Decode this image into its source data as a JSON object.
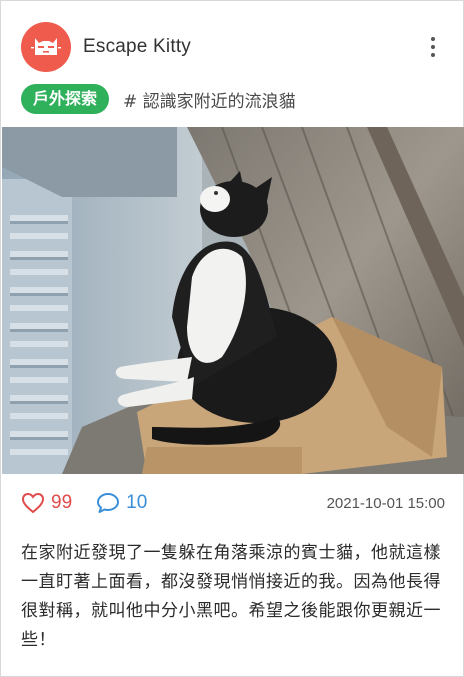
{
  "post": {
    "author": "Escape Kitty",
    "category": "戶外探索",
    "hashtag": "# 認識家附近的流浪貓",
    "likes": "99",
    "comments": "10",
    "timestamp": "2021-10-01 15:00",
    "body": "在家附近發現了一隻躲在角落乘涼的賓士貓，他就這樣一直盯著上面看，都沒發現悄悄接近的我。因為他長得很對稱，就叫他中分小黑吧。希望之後能跟你更親近一些！"
  },
  "icons": {
    "avatar": "cat-face-icon",
    "menu": "more-vertical-icon",
    "like": "heart-outline-icon",
    "comment": "comment-bubble-icon"
  },
  "colors": {
    "avatar_bg": "#ef5b4c",
    "category_badge": "#2fb05b",
    "like": "#e04c4c",
    "comment": "#3a8ed8"
  }
}
